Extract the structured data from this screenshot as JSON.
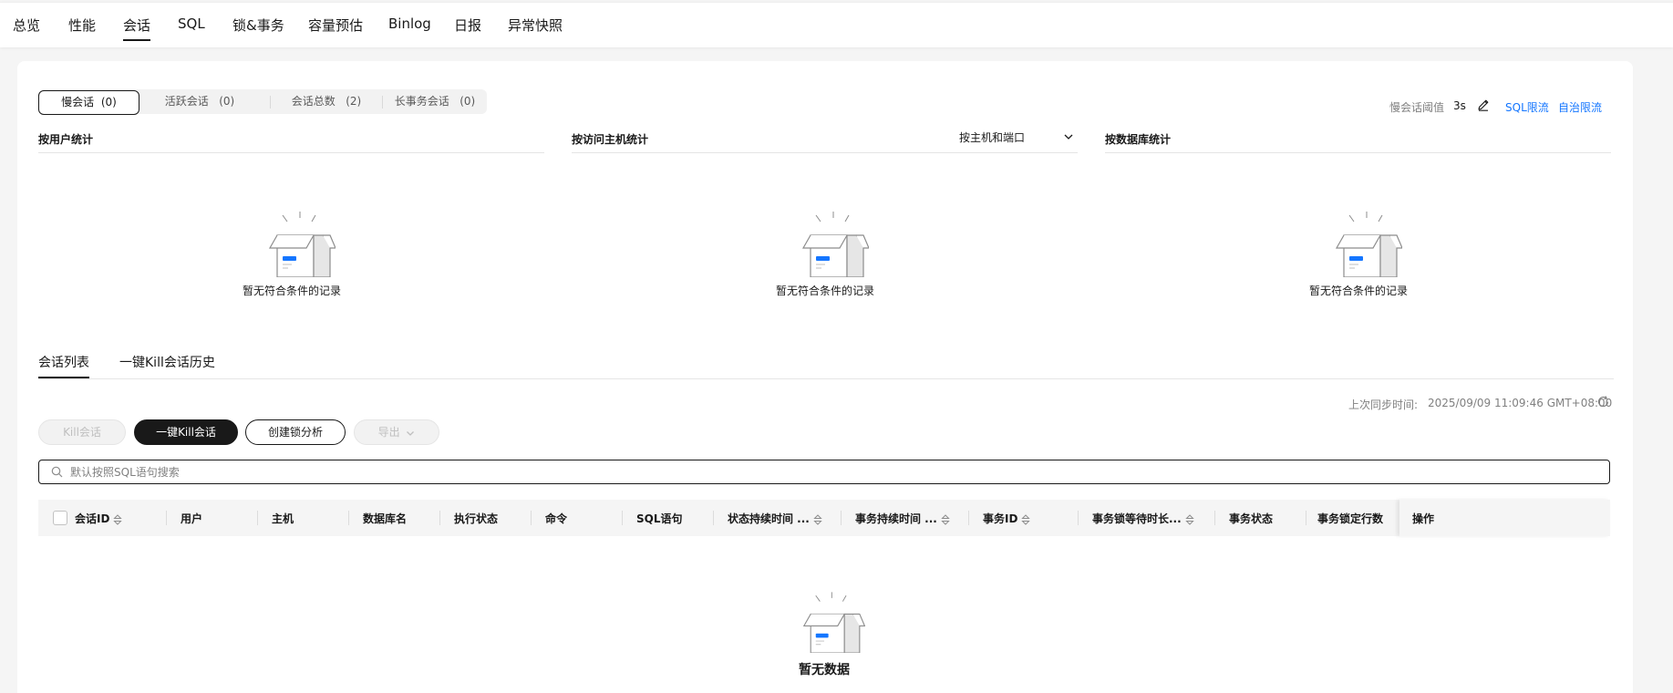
{
  "nav": {
    "tabs": [
      "总览",
      "性能",
      "会话",
      "SQL",
      "锁&事务",
      "容量预估",
      "Binlog",
      "日报",
      "异常快照"
    ],
    "active": "会话"
  },
  "session_filter": {
    "items": [
      {
        "label": "慢会话",
        "count": "(0)"
      },
      {
        "label": "活跃会话",
        "count": "(0)"
      },
      {
        "label": "会话总数",
        "count": "(2)"
      },
      {
        "label": "长事务会话",
        "count": "(0)"
      }
    ]
  },
  "threshold": {
    "label": "慢会话阈值",
    "value": "3s"
  },
  "links": {
    "sql_limit": "SQL限流",
    "auto_limit": "自治限流"
  },
  "stats": {
    "by_user": "按用户统计",
    "by_host": "按访问主机统计",
    "by_db": "按数据库统计",
    "host_select": "按主机和端口"
  },
  "empty_text": "暂无符合条件的记录",
  "tabs": [
    "会话列表",
    "一键Kill会话历史"
  ],
  "sync": {
    "label": "上次同步时间:",
    "time": "2025/09/09 11:09:46 GMT+08:00"
  },
  "buttons": {
    "kill": "Kill会话",
    "kill_all": "一键Kill会话",
    "lock_analysis": "创建锁分析",
    "export": "导出"
  },
  "search": {
    "placeholder": "默认按照SQL语句搜索"
  },
  "table": {
    "columns": [
      "会话ID",
      "用户",
      "主机",
      "数据库名",
      "执行状态",
      "命令",
      "SQL语句",
      "状态持续时间 ...",
      "事务持续时间 ...",
      "事务ID",
      "事务锁等待时长...",
      "事务状态",
      "事务锁定行数",
      "操作"
    ]
  },
  "no_data": "暂无数据",
  "colors": {
    "link": "#1476ff",
    "accent_dark": "#191919",
    "box_blue": "#1476ff"
  }
}
